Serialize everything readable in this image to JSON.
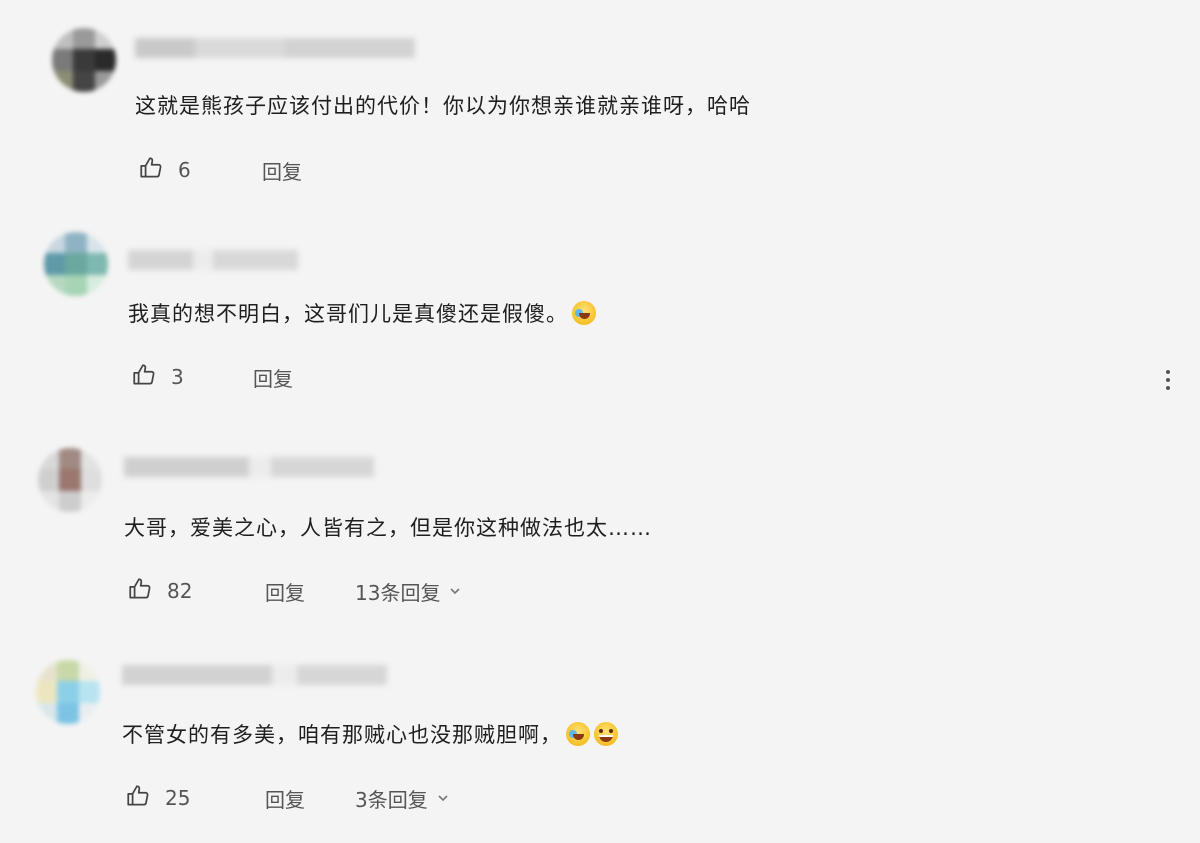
{
  "comments": [
    {
      "text": "这就是熊孩子应该付出的代价！你以为你想亲谁就亲谁呀，哈哈",
      "likes": "6",
      "reply_label": "回复",
      "more_replies": "",
      "emojis": []
    },
    {
      "text": "我真的想不明白，这哥们儿是真傻还是假傻。",
      "likes": "3",
      "reply_label": "回复",
      "more_replies": "",
      "emojis": [
        "laugh-cry"
      ]
    },
    {
      "text": "大哥，爱美之心，人皆有之，但是你这种做法也太……",
      "likes": "82",
      "reply_label": "回复",
      "more_replies": "13条回复",
      "emojis": []
    },
    {
      "text": "不管女的有多美，咱有那贼心也没那贼胆啊，",
      "likes": "25",
      "reply_label": "回复",
      "more_replies": "3条回复",
      "emojis": [
        "laugh-cry",
        "grin"
      ]
    }
  ],
  "icons": {
    "like": "thumbs-up-icon",
    "expand": "chevron-down-icon",
    "menu": "more-vertical-icon"
  },
  "colors": {
    "background": "#f4f4f4",
    "text": "#1e1e1e",
    "secondary_text": "#555555"
  }
}
